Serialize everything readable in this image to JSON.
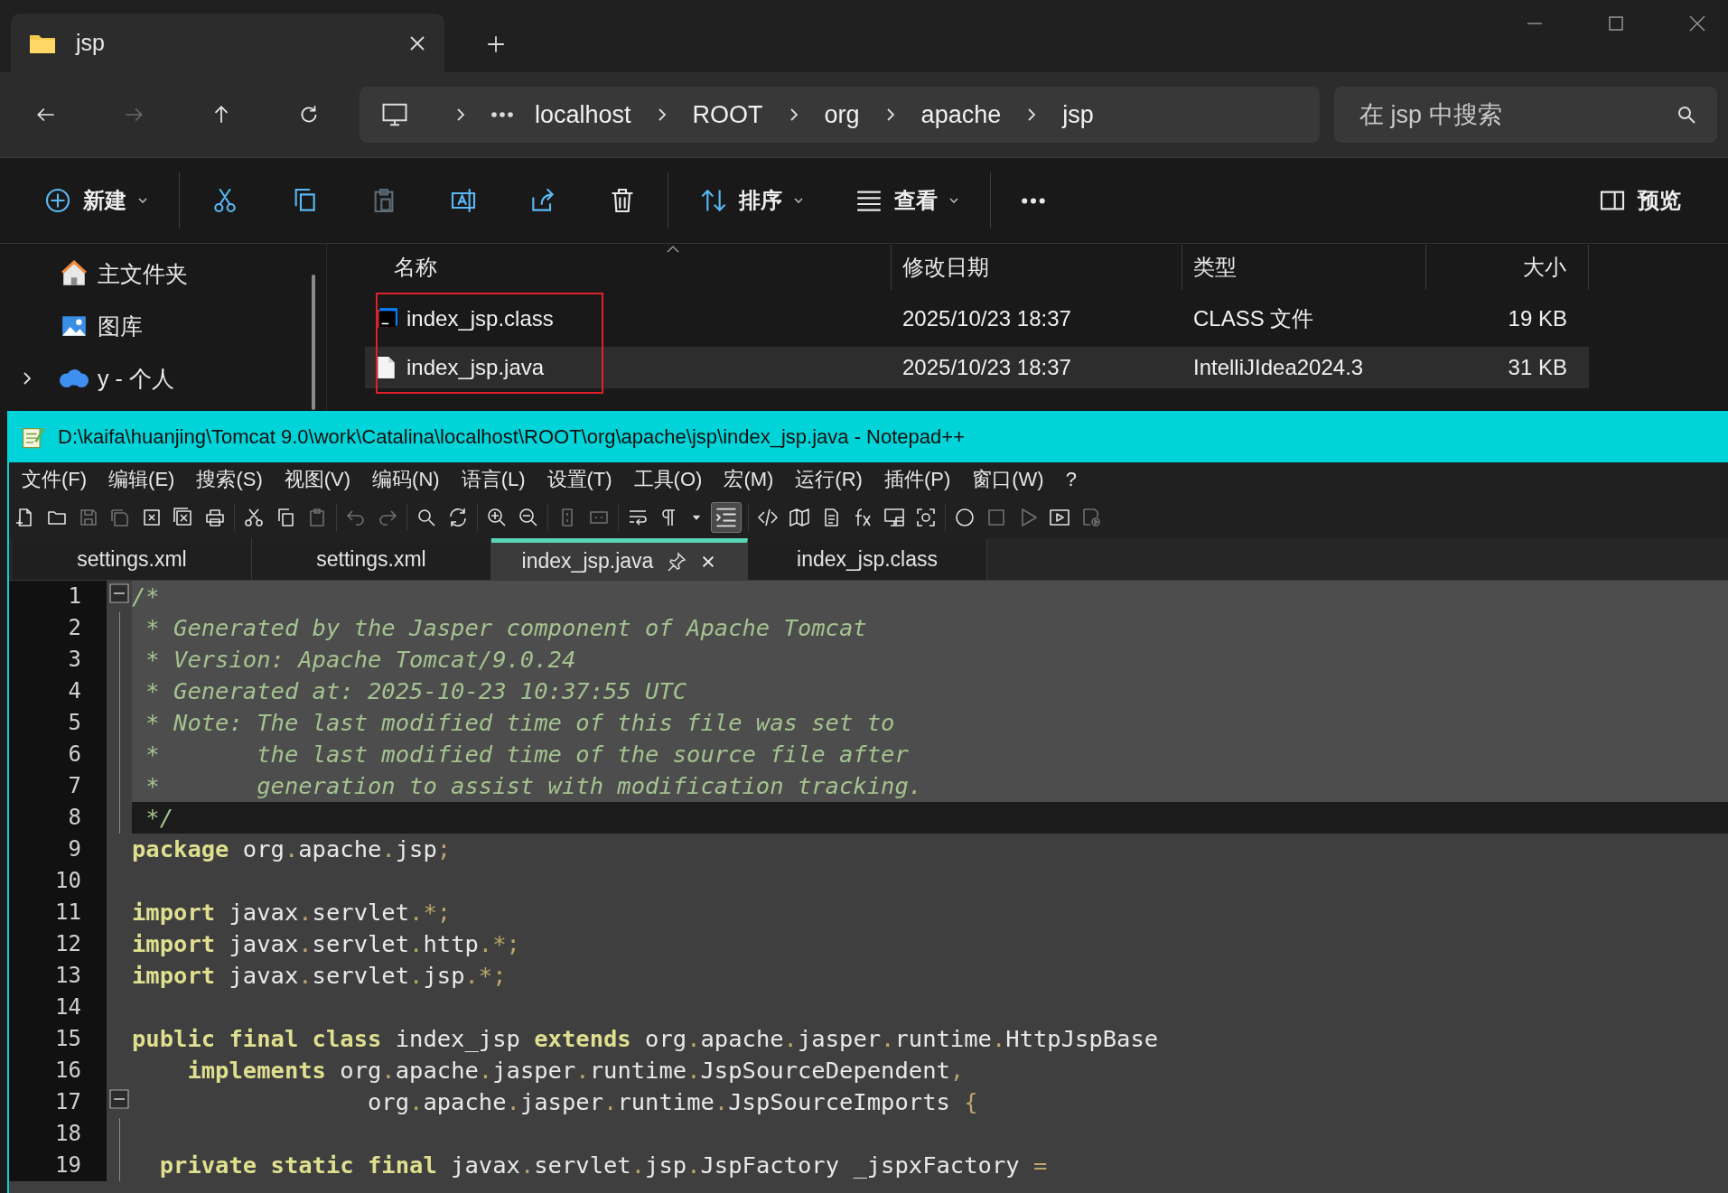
{
  "explorer": {
    "tab": {
      "title": "jsp"
    },
    "nav": [
      {
        "kind": "back",
        "disabled": false
      },
      {
        "kind": "forward",
        "disabled": true
      },
      {
        "kind": "up",
        "disabled": false
      },
      {
        "kind": "refresh",
        "disabled": false
      }
    ],
    "breadcrumb": [
      "localhost",
      "ROOT",
      "org",
      "apache",
      "jsp"
    ],
    "search": {
      "placeholder": "在 jsp 中搜索"
    },
    "toolbar": [
      {
        "kind": "new",
        "label": "新建",
        "disabled": false
      },
      {
        "kind": "cut",
        "disabled": false
      },
      {
        "kind": "copy",
        "disabled": false
      },
      {
        "kind": "paste",
        "disabled": true
      },
      {
        "kind": "rename",
        "disabled": false
      },
      {
        "kind": "share",
        "disabled": false
      },
      {
        "kind": "delete",
        "disabled": false
      },
      {
        "kind": "sort",
        "label": "排序",
        "disabled": false
      },
      {
        "kind": "view",
        "label": "查看",
        "disabled": false
      },
      {
        "kind": "more",
        "disabled": false
      },
      {
        "kind": "preview",
        "label": "预览",
        "disabled": false
      }
    ],
    "sidebar": {
      "items": [
        {
          "label": "主文件夹",
          "kind": "home",
          "expandable": false
        },
        {
          "label": "图库",
          "kind": "gallery",
          "expandable": false
        },
        {
          "label": "y - 个人",
          "kind": "cloud",
          "expandable": true
        }
      ]
    },
    "columns": [
      "名称",
      "修改日期",
      "类型",
      "大小"
    ],
    "files": [
      {
        "name": "index_jsp.class",
        "kind": "class",
        "modified": "2025/10/23 18:37",
        "type": "CLASS 文件",
        "size": "19 KB",
        "selected": false
      },
      {
        "name": "index_jsp.java",
        "kind": "text",
        "modified": "2025/10/23 18:37",
        "type": "IntelliJIdea2024.3",
        "size": "31 KB",
        "selected": true
      }
    ]
  },
  "editor": {
    "title": "D:\\kaifa\\huanjing\\Tomcat 9.0\\work\\Catalina\\localhost\\ROOT\\org\\apache\\jsp\\index_jsp.java - Notepad++",
    "menu": [
      "文件(F)",
      "编辑(E)",
      "搜索(S)",
      "视图(V)",
      "编码(N)",
      "语言(L)",
      "设置(T)",
      "工具(O)",
      "宏(M)",
      "运行(R)",
      "插件(P)",
      "窗口(W)",
      "?"
    ],
    "toolbar": [
      {
        "kind": "new",
        "disabled": false,
        "on": false
      },
      {
        "kind": "open",
        "disabled": false,
        "on": false
      },
      {
        "kind": "save",
        "disabled": true,
        "on": false
      },
      {
        "kind": "saveall",
        "disabled": true,
        "on": false
      },
      {
        "kind": "close",
        "disabled": false,
        "on": false
      },
      {
        "kind": "closeall",
        "disabled": false,
        "on": false
      },
      {
        "kind": "print",
        "disabled": false,
        "on": false
      },
      {
        "kind": "cut",
        "disabled": false,
        "on": false
      },
      {
        "kind": "copy",
        "disabled": false,
        "on": false
      },
      {
        "kind": "paste",
        "disabled": true,
        "on": false
      },
      {
        "kind": "undo",
        "disabled": true,
        "on": false
      },
      {
        "kind": "redo",
        "disabled": true,
        "on": false
      },
      {
        "kind": "find",
        "disabled": false,
        "on": false
      },
      {
        "kind": "replace",
        "disabled": false,
        "on": false
      },
      {
        "kind": "zoomin",
        "disabled": false,
        "on": false
      },
      {
        "kind": "zoomout",
        "disabled": false,
        "on": false
      },
      {
        "kind": "syncv",
        "disabled": true,
        "on": false
      },
      {
        "kind": "synch",
        "disabled": true,
        "on": false
      },
      {
        "kind": "wrap",
        "disabled": false,
        "on": false
      },
      {
        "kind": "pilcrow",
        "disabled": false,
        "on": false
      },
      {
        "kind": "dropdown",
        "disabled": false,
        "on": false
      },
      {
        "kind": "indent",
        "disabled": false,
        "on": true
      },
      {
        "kind": "xml",
        "disabled": false,
        "on": false
      },
      {
        "kind": "map",
        "disabled": false,
        "on": false
      },
      {
        "kind": "doc",
        "disabled": false,
        "on": false
      },
      {
        "kind": "fx",
        "disabled": false,
        "on": false
      },
      {
        "kind": "monitor",
        "disabled": false,
        "on": false
      },
      {
        "kind": "focus",
        "disabled": false,
        "on": false
      },
      {
        "kind": "record",
        "disabled": false,
        "on": false
      },
      {
        "kind": "stop",
        "disabled": true,
        "on": false
      },
      {
        "kind": "play",
        "disabled": true,
        "on": false
      },
      {
        "kind": "playbox",
        "disabled": false,
        "on": false
      },
      {
        "kind": "savemacro",
        "disabled": true,
        "on": false
      }
    ],
    "tabs": [
      {
        "label": "settings.xml",
        "selected": false
      },
      {
        "label": "settings.xml",
        "selected": false
      },
      {
        "label": "index_jsp.java",
        "selected": true
      },
      {
        "label": "index_jsp.class",
        "selected": false
      }
    ],
    "lines": [
      {
        "number": "1",
        "kind": "comment",
        "fold_box": true,
        "tokens": [
          {
            "kind": "cm",
            "text": "/*"
          }
        ]
      },
      {
        "number": "2",
        "kind": "comment",
        "tokens": [
          {
            "kind": "cm",
            "text": " * Generated by the Jasper component of Apache Tomcat"
          }
        ]
      },
      {
        "number": "3",
        "kind": "comment",
        "tokens": [
          {
            "kind": "cm",
            "text": " * Version: Apache Tomcat/9.0.24"
          }
        ]
      },
      {
        "number": "4",
        "kind": "comment",
        "tokens": [
          {
            "kind": "cm",
            "text": " * Generated at: 2025-10-23 10:37:55 UTC"
          }
        ]
      },
      {
        "number": "5",
        "kind": "comment",
        "tokens": [
          {
            "kind": "cm",
            "text": " * Note: The last modified time of this file was set to"
          }
        ]
      },
      {
        "number": "6",
        "kind": "comment",
        "tokens": [
          {
            "kind": "cm",
            "text": " *       the last modified time of the source file after"
          }
        ]
      },
      {
        "number": "7",
        "kind": "comment",
        "tokens": [
          {
            "kind": "cm",
            "text": " *       generation to assist with modification tracking."
          }
        ]
      },
      {
        "number": "8",
        "kind": "current",
        "tokens": [
          {
            "kind": "cm",
            "text": " */"
          }
        ]
      },
      {
        "number": "9",
        "kind": "code",
        "tokens": [
          {
            "kind": "kw",
            "text": "package"
          },
          {
            "kind": "id",
            "text": " org"
          },
          {
            "kind": "op",
            "text": "."
          },
          {
            "kind": "id",
            "text": "apache"
          },
          {
            "kind": "op",
            "text": "."
          },
          {
            "kind": "id",
            "text": "jsp"
          },
          {
            "kind": "op",
            "text": ";"
          }
        ]
      },
      {
        "number": "10",
        "kind": "code"
      },
      {
        "number": "11",
        "kind": "code",
        "tokens": [
          {
            "kind": "kw",
            "text": "import"
          },
          {
            "kind": "id",
            "text": " javax"
          },
          {
            "kind": "op",
            "text": "."
          },
          {
            "kind": "id",
            "text": "servlet"
          },
          {
            "kind": "op",
            "text": ".*;"
          }
        ]
      },
      {
        "number": "12",
        "kind": "code",
        "tokens": [
          {
            "kind": "kw",
            "text": "import"
          },
          {
            "kind": "id",
            "text": " javax"
          },
          {
            "kind": "op",
            "text": "."
          },
          {
            "kind": "id",
            "text": "servlet"
          },
          {
            "kind": "op",
            "text": "."
          },
          {
            "kind": "id",
            "text": "http"
          },
          {
            "kind": "op",
            "text": ".*;"
          }
        ]
      },
      {
        "number": "13",
        "kind": "code",
        "tokens": [
          {
            "kind": "kw",
            "text": "import"
          },
          {
            "kind": "id",
            "text": " javax"
          },
          {
            "kind": "op",
            "text": "."
          },
          {
            "kind": "id",
            "text": "servlet"
          },
          {
            "kind": "op",
            "text": "."
          },
          {
            "kind": "id",
            "text": "jsp"
          },
          {
            "kind": "op",
            "text": ".*;"
          }
        ]
      },
      {
        "number": "14",
        "kind": "code"
      },
      {
        "number": "15",
        "kind": "code",
        "tokens": [
          {
            "kind": "kw",
            "text": "public final class"
          },
          {
            "kind": "id",
            "text": " index_jsp "
          },
          {
            "kind": "kw",
            "text": "extends"
          },
          {
            "kind": "id",
            "text": " org"
          },
          {
            "kind": "op",
            "text": "."
          },
          {
            "kind": "id",
            "text": "apache"
          },
          {
            "kind": "op",
            "text": "."
          },
          {
            "kind": "id",
            "text": "jasper"
          },
          {
            "kind": "op",
            "text": "."
          },
          {
            "kind": "id",
            "text": "runtime"
          },
          {
            "kind": "op",
            "text": "."
          },
          {
            "kind": "id",
            "text": "HttpJspBase"
          }
        ]
      },
      {
        "number": "16",
        "kind": "code",
        "tokens": [
          {
            "kind": "kw",
            "text": "    implements"
          },
          {
            "kind": "id",
            "text": " org"
          },
          {
            "kind": "op",
            "text": "."
          },
          {
            "kind": "id",
            "text": "apache"
          },
          {
            "kind": "op",
            "text": "."
          },
          {
            "kind": "id",
            "text": "jasper"
          },
          {
            "kind": "op",
            "text": "."
          },
          {
            "kind": "id",
            "text": "runtime"
          },
          {
            "kind": "op",
            "text": "."
          },
          {
            "kind": "id",
            "text": "JspSourceDependent"
          },
          {
            "kind": "op",
            "text": ","
          }
        ]
      },
      {
        "number": "17",
        "kind": "code",
        "fold_box": true,
        "tokens": [
          {
            "kind": "id",
            "text": "                 org"
          },
          {
            "kind": "op",
            "text": "."
          },
          {
            "kind": "id",
            "text": "apache"
          },
          {
            "kind": "op",
            "text": "."
          },
          {
            "kind": "id",
            "text": "jasper"
          },
          {
            "kind": "op",
            "text": "."
          },
          {
            "kind": "id",
            "text": "runtime"
          },
          {
            "kind": "op",
            "text": "."
          },
          {
            "kind": "id",
            "text": "JspSourceImports "
          },
          {
            "kind": "op",
            "text": "{"
          }
        ]
      },
      {
        "number": "18",
        "kind": "code"
      },
      {
        "number": "19",
        "kind": "code",
        "tokens": [
          {
            "kind": "kw",
            "text": "  private static final"
          },
          {
            "kind": "id",
            "text": " javax"
          },
          {
            "kind": "op",
            "text": "."
          },
          {
            "kind": "id",
            "text": "servlet"
          },
          {
            "kind": "op",
            "text": "."
          },
          {
            "kind": "id",
            "text": "jsp"
          },
          {
            "kind": "op",
            "text": "."
          },
          {
            "kind": "id",
            "text": "JspFactory _jspxFactory "
          },
          {
            "kind": "op",
            "text": "="
          }
        ]
      }
    ]
  }
}
